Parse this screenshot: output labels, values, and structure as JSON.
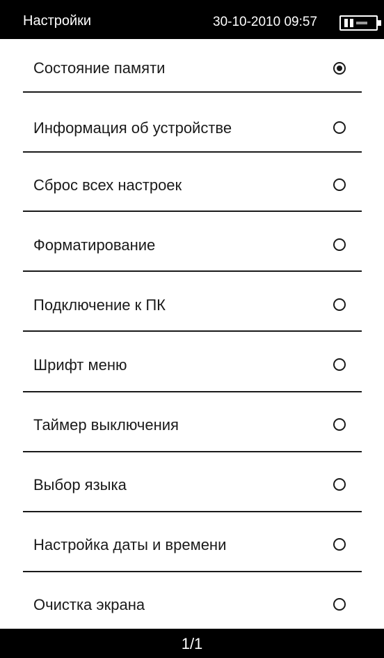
{
  "status_bar": {
    "title": "Настройки",
    "datetime": "30-10-2010  09:57",
    "battery_icon": "battery-icon"
  },
  "menu": {
    "items": [
      {
        "label": "Состояние памяти",
        "selected": true
      },
      {
        "label": "Информация об устройстве",
        "selected": false
      },
      {
        "label": "Сброс всех настроек",
        "selected": false
      },
      {
        "label": "Форматирование",
        "selected": false
      },
      {
        "label": "Подключение к ПК",
        "selected": false
      },
      {
        "label": "Шрифт меню",
        "selected": false
      },
      {
        "label": "Таймер выключения",
        "selected": false
      },
      {
        "label": "Выбор языка",
        "selected": false
      },
      {
        "label": "Настройка даты и времени",
        "selected": false
      },
      {
        "label": "Очистка экрана",
        "selected": false
      }
    ]
  },
  "footer": {
    "page_indicator": "1/1"
  },
  "colors": {
    "bar_background": "#000000",
    "text": "#1a1a1a",
    "background": "#ffffff"
  }
}
